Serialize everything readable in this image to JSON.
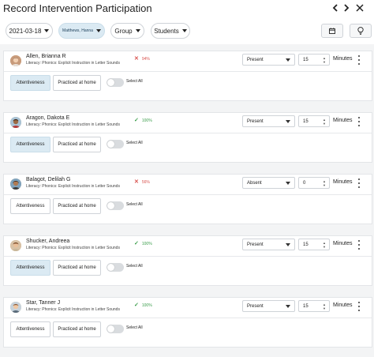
{
  "header": {
    "title": "Record Intervention Participation",
    "icons": [
      "chevron-left-icon",
      "chevron-right-icon",
      "close-icon"
    ]
  },
  "toolbar": {
    "date": "2021-03-18",
    "teacher": "Matthews, Hanna",
    "group": "Group",
    "students": "Students",
    "calendar_icon": "calendar-icon",
    "lightbulb_icon": "lightbulb-icon"
  },
  "colors": {
    "accent_bg": "#dbeaf3",
    "low_status": "#d9534f",
    "high_status": "#3a9d4a",
    "list_bg": "#f3f4f5"
  },
  "students": [
    {
      "name": "Allen, Brianna R",
      "subject": "Literacy: Phonics: Explicit Instruction in Letter Sounds",
      "status_icon": "x-icon",
      "status_level": "low",
      "percent": "94%",
      "attendance": "Present",
      "minutes_value": "15",
      "minutes_label": "Minutes",
      "tag_attentiveness": "Attentiveness",
      "tag_attentiveness_selected": true,
      "tag_home": "Practiced at home",
      "select_all": "Select All"
    },
    {
      "name": "Aragon, Dakota E",
      "subject": "Literacy: Phonics: Explicit Instruction in Letter Sounds",
      "status_icon": "check-icon",
      "status_level": "high",
      "percent": "100%",
      "attendance": "Present",
      "minutes_value": "15",
      "minutes_label": "Minutes",
      "tag_attentiveness": "Attentiveness",
      "tag_attentiveness_selected": true,
      "tag_home": "Practiced at home",
      "select_all": "Select All"
    },
    {
      "name": "Balagot, Delilah G",
      "subject": "Literacy: Phonics: Explicit Instruction in Letter Sounds",
      "status_icon": "x-icon",
      "status_level": "low",
      "percent": "56%",
      "attendance": "Absent",
      "minutes_value": "0",
      "minutes_label": "Minutes",
      "tag_attentiveness": "Attentiveness",
      "tag_attentiveness_selected": false,
      "tag_home": "Practiced at home",
      "select_all": "Select All"
    },
    {
      "name": "Shucker, Andreea",
      "subject": "Literacy: Phonics: Explicit Instruction in Letter Sounds",
      "status_icon": "check-icon",
      "status_level": "high",
      "percent": "100%",
      "attendance": "Present",
      "minutes_value": "15",
      "minutes_label": "Minutes",
      "tag_attentiveness": "Attentiveness",
      "tag_attentiveness_selected": true,
      "tag_home": "Practiced at home",
      "select_all": "Select All"
    },
    {
      "name": "Star, Tanner J",
      "subject": "Literacy: Phonics: Explicit Instruction in Letter Sounds",
      "status_icon": "check-icon",
      "status_level": "high",
      "percent": "100%",
      "attendance": "Present",
      "minutes_value": "15",
      "minutes_label": "Minutes",
      "tag_attentiveness": "Attentiveness",
      "tag_attentiveness_selected": false,
      "tag_home": "Practiced at home",
      "select_all": "Select All"
    }
  ]
}
